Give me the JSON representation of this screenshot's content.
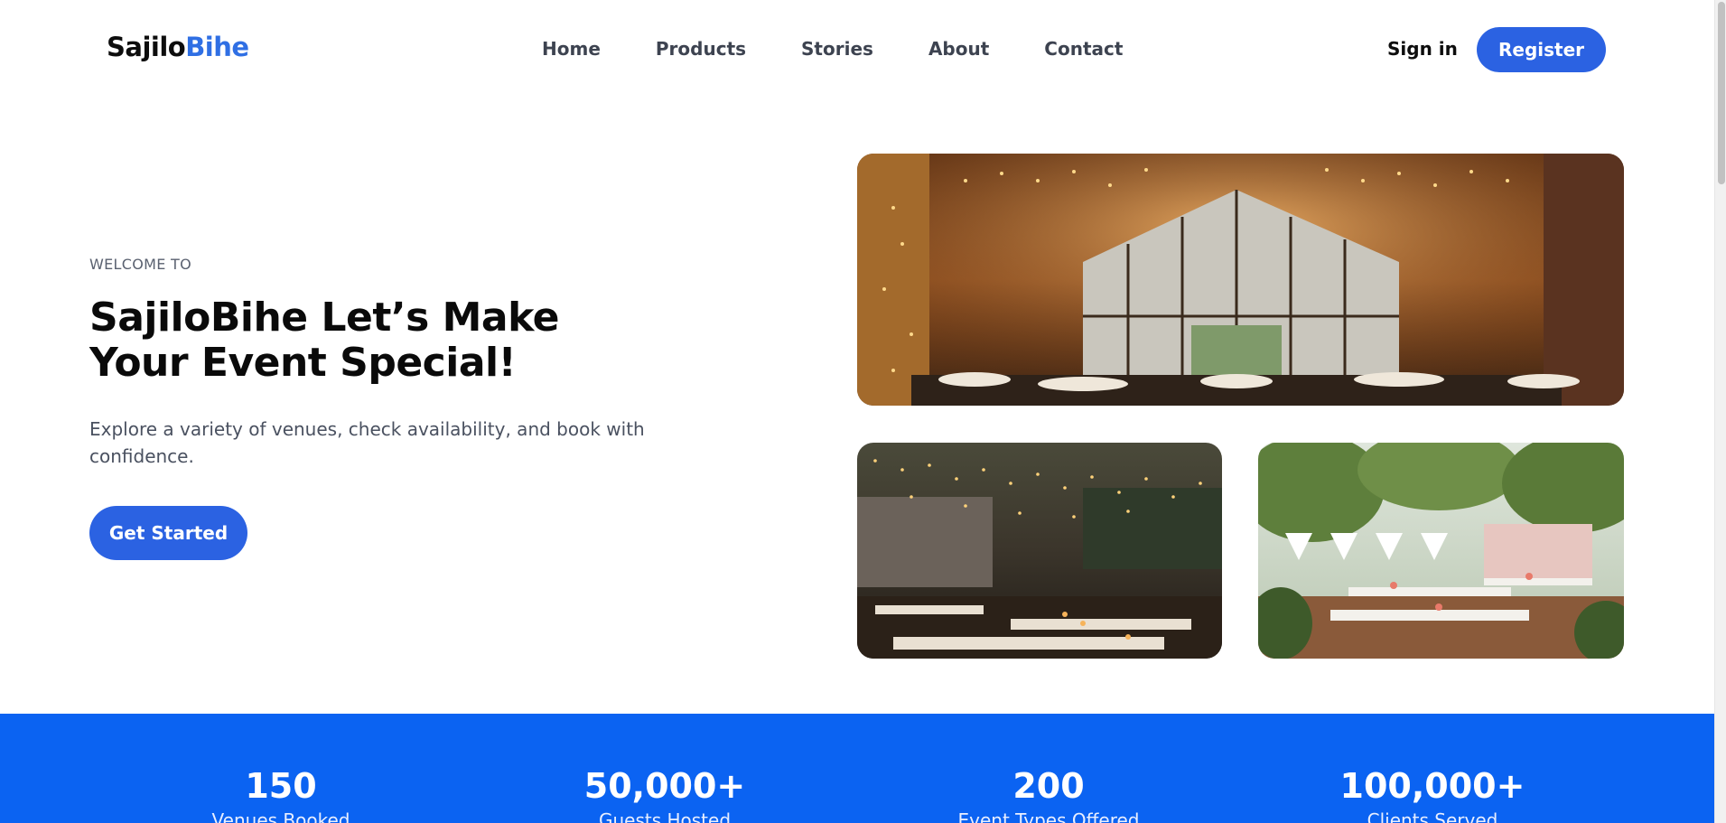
{
  "brand": {
    "part1": "Sajilo",
    "part2": "Bihe",
    "accent_color": "#2f6fe4"
  },
  "nav": {
    "items": [
      "Home",
      "Products",
      "Stories",
      "About",
      "Contact"
    ]
  },
  "auth": {
    "signin_label": "Sign in",
    "register_label": "Register"
  },
  "hero": {
    "eyebrow": "WELCOME TO",
    "title": "SajiloBihe Let’s Make Your Event Special!",
    "description": "Explore a variety of venues, check availability, and book with confidence.",
    "cta_label": "Get Started",
    "images": [
      {
        "name": "barn-venue-photo"
      },
      {
        "name": "string-lights-courtyard-photo"
      },
      {
        "name": "garden-tent-reception-photo"
      }
    ]
  },
  "stats": {
    "background": "#0b63f2",
    "items": [
      {
        "value": "150",
        "label": "Venues Booked"
      },
      {
        "value": "50,000+",
        "label": "Guests Hosted"
      },
      {
        "value": "200",
        "label": "Event Types Offered"
      },
      {
        "value": "100,000+",
        "label": "Clients Served"
      }
    ]
  },
  "colors": {
    "primary": "#2b62e2",
    "text_dark": "#0a0a0a",
    "text_muted": "#4a5160"
  }
}
